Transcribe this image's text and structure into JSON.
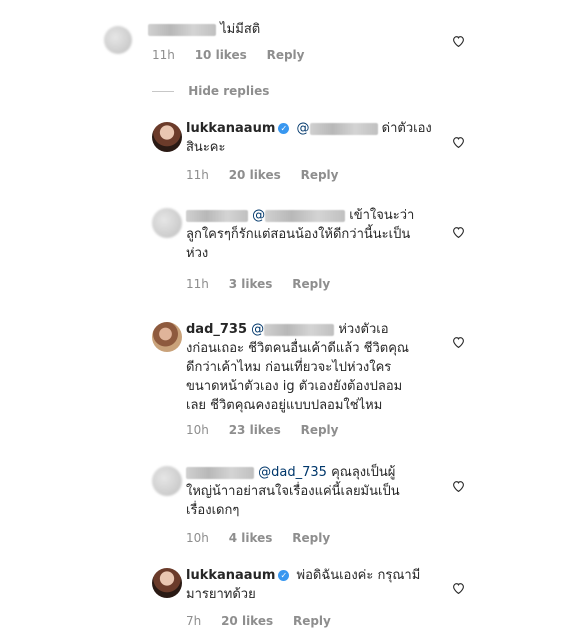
{
  "comments": [
    {
      "text": "ไม่มีสติ",
      "time": "11h",
      "likes": "10 likes",
      "reply": "Reply"
    },
    {
      "username": "lukkanaaum",
      "mention": "@",
      "text_line1": "ด่าตัวเอง",
      "text_line2": "สินะคะ",
      "time": "11h",
      "likes": "20 likes",
      "reply": "Reply"
    },
    {
      "mention": "@",
      "text_line1": "เข้าใจนะว่า",
      "text_line2": "ลูกใครๆก็รักแต่สอนน้องให้ดีกว่านี้นะเป็น",
      "text_line3": "ห่วง",
      "time": "11h",
      "likes": "3 likes",
      "reply": "Reply"
    },
    {
      "username": "dad_735",
      "mention": "@",
      "text_line1": "ห่วงตัวเอ",
      "text_line2": "งก่อนเถอะ ชีวิตคนอื่นเค้าดีแล้ว ชีวิตคุณ",
      "text_line3": "ดีกว่าเค้าไหม ก่อนเที่ยวจะไปห่วงใคร",
      "text_line4": "ขนาดหน้าตัวเอง ig ตัวเองยังต้องปลอม",
      "text_line5": "เลย ชีวิตคุณคงอยู่แบบปลอมใช่ไหม",
      "time": "10h",
      "likes": "23 likes",
      "reply": "Reply"
    },
    {
      "mention": "@dad_735",
      "text_line1": "คุณลุงเป็นผู้",
      "text_line2": "ใหญ่น้าาอย่าสนใจเรื่องแค่นี้เลยมันเป็น",
      "text_line3": "เรื่องเดกๆ",
      "time": "10h",
      "likes": "4 likes",
      "reply": "Reply"
    },
    {
      "username": "lukkanaaum",
      "text_line1": "พ่อดิฉันเองค่ะ กรุณามี",
      "text_line2": "มารยาทด้วย",
      "time": "7h",
      "likes": "20 likes",
      "reply": "Reply"
    }
  ],
  "hide_replies": "Hide replies",
  "icons": {
    "heart": "heart-outline-icon",
    "verified": "verified-badge-icon"
  },
  "colors": {
    "verified": "#3897f0",
    "meta": "#8e8e8e",
    "mention": "#00376b"
  }
}
